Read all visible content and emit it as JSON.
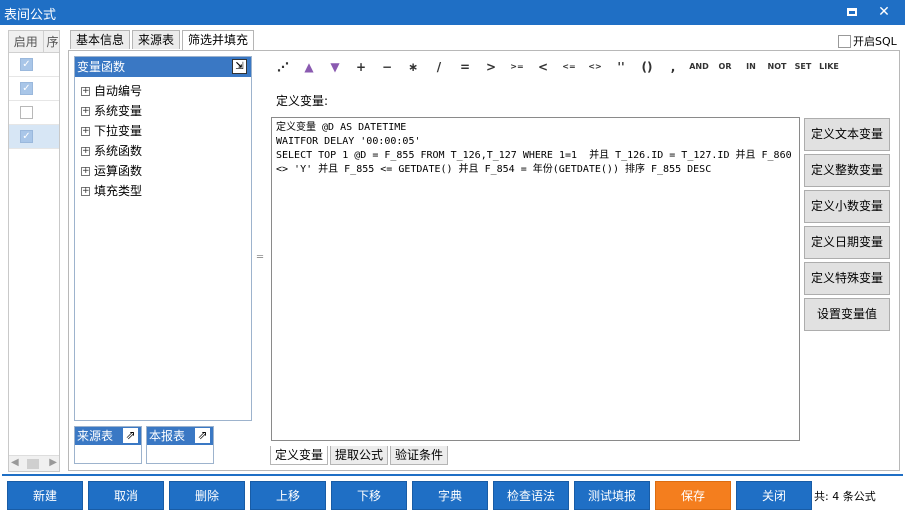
{
  "window": {
    "title": "表间公式"
  },
  "left_grid": {
    "header": [
      "启用",
      "序"
    ],
    "rows": [
      {
        "enabled": true,
        "selected": false
      },
      {
        "enabled": true,
        "selected": false
      },
      {
        "enabled": false,
        "selected": false
      },
      {
        "enabled": true,
        "selected": true
      }
    ]
  },
  "top_tabs": [
    "基本信息",
    "来源表",
    "筛选并填充"
  ],
  "sql_toggle": {
    "label": "开启SQL",
    "checked": false
  },
  "tree": {
    "title": "变量函数",
    "items": [
      "自动编号",
      "系统变量",
      "下拉变量",
      "系统函数",
      "运算函数",
      "填充类型"
    ]
  },
  "mini_panels": {
    "source": "来源表",
    "report": "本报表"
  },
  "operators": [
    "+",
    "−",
    "∗",
    "/",
    "=",
    ">",
    ">=",
    "<",
    "<=",
    "<>",
    "''",
    "()",
    ",",
    "AND",
    "OR",
    "IN",
    "NOT",
    "SET",
    "LIKE"
  ],
  "define_label": "定义变量:",
  "editor_text": "定义变量 @D AS DATETIME\nWAITFOR DELAY '00:00:05'\nSELECT TOP 1 @D = F_855 FROM T_126,T_127 WHERE 1=1  并且 T_126.ID = T_127.ID 并且 F_860 <> 'Y' 并且 F_855 <= GETDATE() 并且 F_854 = 年份(GETDATE()) 排序 F_855 DESC",
  "side_buttons": [
    "定义文本变量",
    "定义整数变量",
    "定义小数变量",
    "定义日期变量",
    "定义特殊变量",
    "设置变量值"
  ],
  "bottom_tabs": [
    "定义变量",
    "提取公式",
    "验证条件"
  ],
  "actions": [
    "新建",
    "取消",
    "删除",
    "上移",
    "下移",
    "字典",
    "检查语法",
    "测试填报",
    "保存",
    "关闭"
  ],
  "count_text": "共: 4 条公式",
  "colors": {
    "titlebar": "#1f6fc5",
    "action": "#1f6fc5",
    "save": "#f47e1e"
  }
}
